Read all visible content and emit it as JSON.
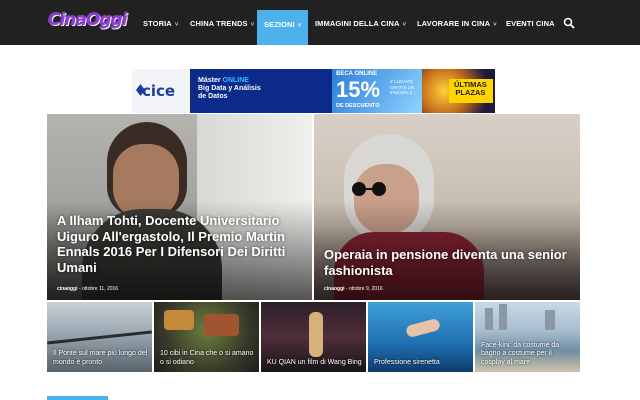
{
  "navbar": {
    "logo_text": "CinaOggi",
    "items": [
      {
        "label": "STORIA",
        "has_dropdown": true,
        "active": false
      },
      {
        "label": "CHINA TRENDS",
        "has_dropdown": true,
        "active": false
      },
      {
        "label": "SEZIONI",
        "has_dropdown": true,
        "active": true
      },
      {
        "label": "IMMAGINI DELLA CINA",
        "has_dropdown": true,
        "active": false
      },
      {
        "label": "LAVORARE IN CINA",
        "has_dropdown": true,
        "active": false
      },
      {
        "label": "EVENTI CINA",
        "has_dropdown": false,
        "active": false
      }
    ],
    "search_icon": "search-icon",
    "chevron": "˅"
  },
  "ad": {
    "brand": "cice",
    "line1a": "Máster ",
    "line1b": "ONLINE",
    "line2": "Big Data y Análisis",
    "line3": "de Datos",
    "beca": "BECA ONLINE",
    "pct": "15%",
    "descuento": "DE DESCUENTO",
    "ipad_line1": "Y LLÉVATE",
    "ipad_line2": "GRATIS UN",
    "ipad_line3": "iPad Mini 2",
    "plazas1": "ÚLTIMAS",
    "plazas2": "PLAZAS"
  },
  "featured": [
    {
      "title": "A Ilham Tohti, Docente Universitario Uiguro All'ergastolo, Il Premio Martin Ennals 2016 Per I Difensori Dei Diritti Umani",
      "author": "cinaoggi",
      "sep": "-",
      "date": "ottobre 11, 2016"
    },
    {
      "title": "Operaia in pensione diventa una senior fashionista",
      "author": "cinaoggi",
      "sep": "-",
      "date": "ottobre 9, 2016"
    }
  ],
  "small": [
    {
      "title": "Il Ponte sul mare più lungo del mondo è pronto"
    },
    {
      "title": "10 cibi in Cina che o si amano o si odiano"
    },
    {
      "title": "KU QIAN un film di Wang Bing"
    },
    {
      "title": "Professione sirenetta"
    },
    {
      "title": "Face-kini: da costume da bagno a costume per il cosplay al mare"
    }
  ],
  "colors": {
    "nav_bg": "#212121",
    "accent": "#4db2ec",
    "logo": "#8e3bd9"
  }
}
